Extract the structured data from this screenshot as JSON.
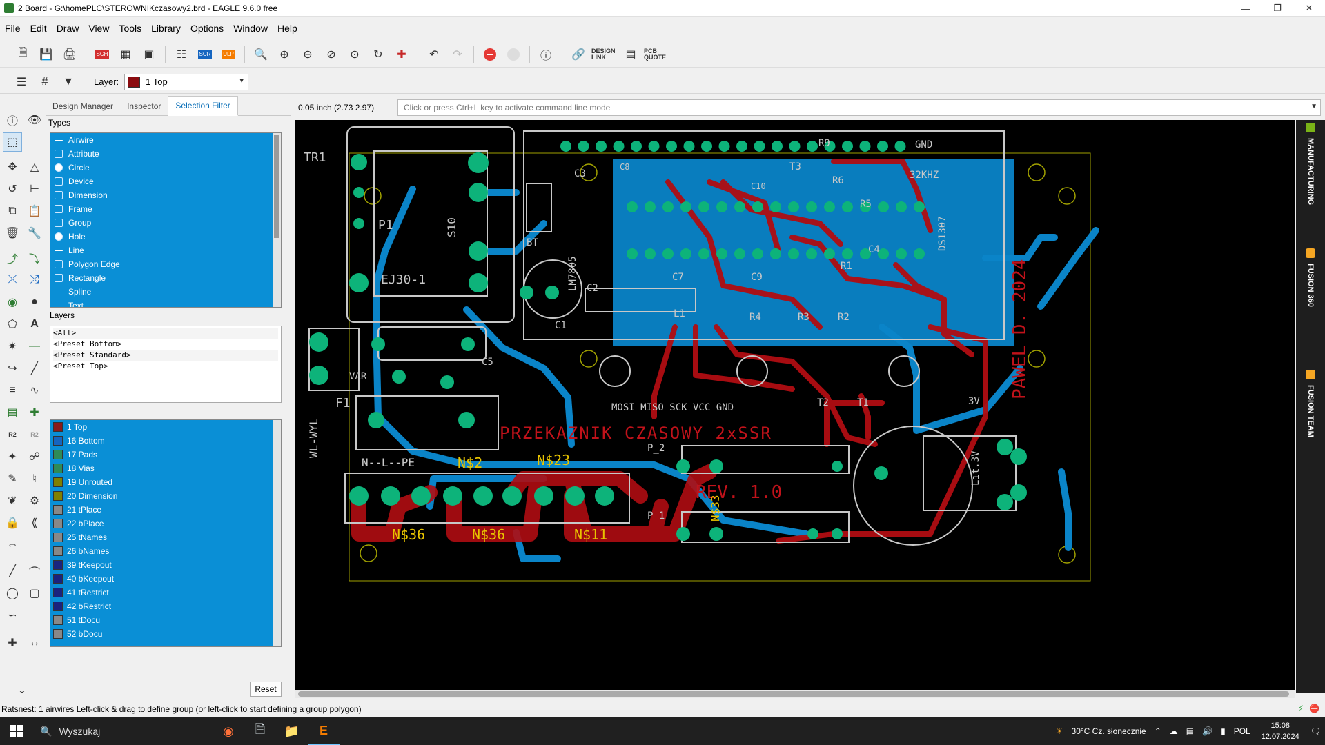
{
  "window": {
    "title": "2 Board - G:\\homePLC\\STEROWNIKczasowy2.brd - EAGLE 9.6.0 free",
    "controls": [
      "minimize-icon",
      "restore-icon",
      "close-icon"
    ]
  },
  "menu": [
    "File",
    "Edit",
    "Draw",
    "View",
    "Tools",
    "Library",
    "Options",
    "Window",
    "Help"
  ],
  "toolbar": {
    "design_link": "DESIGN LINK",
    "pcb_quote": "PCB QUOTE"
  },
  "layer_toolbar": {
    "label": "Layer:",
    "current_layer": "1 Top",
    "current_layer_color": "#8b0c10"
  },
  "panel": {
    "tabs": [
      "Design Manager",
      "Inspector",
      "Selection Filter"
    ],
    "active_tab": "Selection Filter",
    "types_title": "Types",
    "types": [
      "Airwire",
      "Attribute",
      "Circle",
      "Device",
      "Dimension",
      "Frame",
      "Group",
      "Hole",
      "Line",
      "Polygon Edge",
      "Rectangle",
      "Spline",
      "Text"
    ],
    "layers_title": "Layers",
    "presets": [
      "<All>",
      "<Preset_Bottom>",
      "<Preset_Standard>",
      "<Preset_Top>"
    ],
    "layers": [
      {
        "name": "1 Top",
        "color": "#8b1a1a"
      },
      {
        "name": "16 Bottom",
        "color": "#1565c0"
      },
      {
        "name": "17 Pads",
        "color": "#2e8b57"
      },
      {
        "name": "18 Vias",
        "color": "#2e8b57"
      },
      {
        "name": "19 Unrouted",
        "color": "#808000"
      },
      {
        "name": "20 Dimension",
        "color": "#808000"
      },
      {
        "name": "21 tPlace",
        "color": "#888888"
      },
      {
        "name": "22 bPlace",
        "color": "#888888"
      },
      {
        "name": "25 tNames",
        "color": "#888888"
      },
      {
        "name": "26 bNames",
        "color": "#888888"
      },
      {
        "name": "39 tKeepout",
        "color": "#1a237e"
      },
      {
        "name": "40 bKeepout",
        "color": "#1a237e"
      },
      {
        "name": "41 tRestrict",
        "color": "#1a237e"
      },
      {
        "name": "42 bRestrict",
        "color": "#1a237e"
      },
      {
        "name": "51 tDocu",
        "color": "#888888"
      },
      {
        "name": "52 bDocu",
        "color": "#888888"
      }
    ],
    "reset": "Reset"
  },
  "coord": "0.05 inch (2.73 2.97)",
  "command_placeholder": "Click or press Ctrl+L key to activate command line mode",
  "board_labels": {
    "tr1": "TR1",
    "p1": "P1",
    "s10": "S10",
    "ej": "EJ30-1",
    "bt": "BT",
    "lm": "LM7805",
    "c1": "C1",
    "c2": "C2",
    "c3": "C3",
    "c4": "C4",
    "c5": "C5",
    "c7": "C7",
    "c8": "C8",
    "c9": "C9",
    "c10": "C10",
    "r1": "R1",
    "r2": "R2",
    "r3": "R3",
    "r4": "R4",
    "r5": "R5",
    "r6": "R6",
    "r9": "R9",
    "t1": "T1",
    "t2": "T2",
    "t3": "T3",
    "gnd": "GND",
    "khz": "32KHZ",
    "ds": "DS1307",
    "l1": "L1",
    "f1": "F1",
    "var": "VAR",
    "wl": "WL-WYL",
    "nlpe": "N--L--PE",
    "title": "PRZEKAZNIK CZASOWY 2xSSR",
    "rev": "REV. 1.0",
    "author": "PAWEL D. 2024",
    "isp": "MOSI_MISO_SCK_VCC_GND",
    "v3": "3V",
    "lit": "Lit.3V",
    "p2": "P_2",
    "p_1": "P_1",
    "ns2": "N$2",
    "ns23": "N$23",
    "ns36a": "N$36",
    "ns36b": "N$36",
    "ns11": "N$11",
    "ns33": "N$33"
  },
  "right_rail": [
    "MANUFACTURING",
    "FUSION 360",
    "FUSION TEAM"
  ],
  "status": "Ratsnest: 1 airwires Left-click & drag to define group (or left-click to start defining a group polygon)",
  "taskbar": {
    "search": "Wyszukaj",
    "weather": "30°C  Cz. słonecznie",
    "lang": "POL",
    "time": "15:08",
    "date": "12.07.2024"
  }
}
